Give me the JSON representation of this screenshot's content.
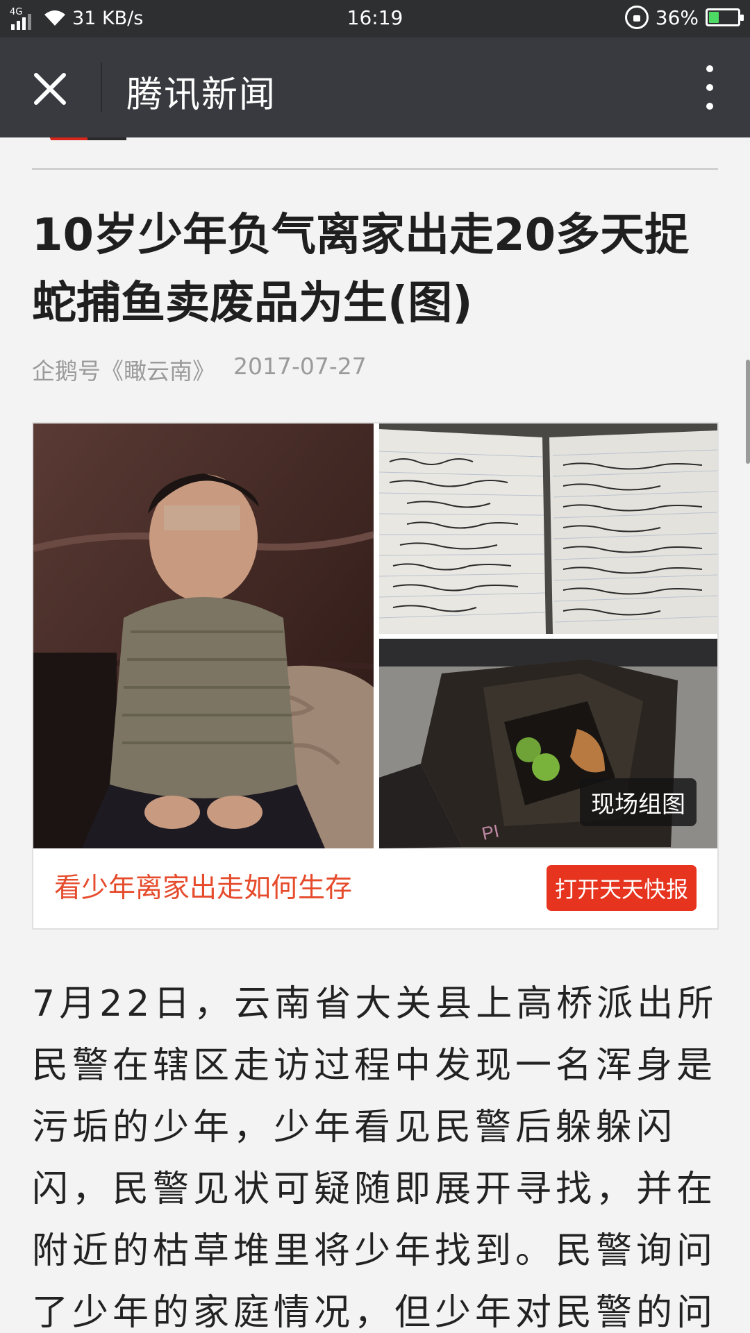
{
  "status_bar": {
    "network_label": "4G",
    "speed": "31 KB/s",
    "time": "16:19",
    "battery": "36%",
    "battery_level": 0.36,
    "battery_color": "#4cd964"
  },
  "app_bar": {
    "title": "腾讯新闻",
    "close_icon": "close-icon",
    "more_icon": "more-vertical-icon"
  },
  "article": {
    "title": "10岁少年负气离家出走20多天捉蛇捕鱼卖废品为生(图)",
    "source": "企鹅号《瞰云南》",
    "date": "2017-07-27",
    "image_card": {
      "badge": "现场组图",
      "caption": "看少年离家出走如何生存",
      "open_button": "打开天天快报",
      "caption_color": "#e64b2c",
      "button_color": "#e7341f"
    },
    "body": "7月22日，云南省大关县上高桥派出所民警在辖区走访过程中发现一名浑身是污垢的少年，少年看见民警后躲躲闪闪，民警见状可疑随即展开寻找，并在附近的枯草堆里将少年找到。民警询问了少年的家庭情况，但少年对民警的问"
  }
}
